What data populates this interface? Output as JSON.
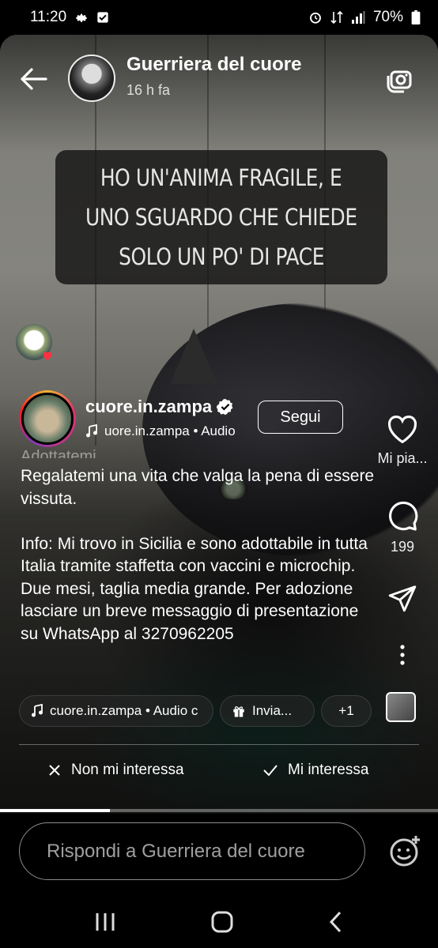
{
  "status_bar": {
    "time": "11:20",
    "battery": "70%",
    "left_icons": [
      "gear-icon",
      "checkbox-icon"
    ],
    "right_icons": [
      "alarm-icon",
      "data-icon",
      "signal-icon",
      "battery-icon"
    ]
  },
  "story_header": {
    "username": "Guerriera del cuore",
    "time_ago": "16 h fa"
  },
  "quote": {
    "lines": [
      "HO UN'ANIMA FRAGILE, E",
      "UNO SGUARDO CHE CHIEDE",
      "SOLO UN PO' DI PACE"
    ]
  },
  "post": {
    "username": "cuore.in.zampa",
    "audio": "uore.in.zampa • Audio",
    "follow_label": "Segui",
    "caption_partial": "Adottatemi.",
    "caption": "Regalatemi una vita che valga la pena di essere vissuta.\n\nInfo: Mi trovo in Sicilia e sono adottabile in tutta Italia tramite staffetta con vaccini e microchip. Due mesi, taglia media grande. Per adozione lasciare un breve messaggio di presentazione su WhatsApp al 3270962205"
  },
  "actions": {
    "like_label": "Mi pia...",
    "comments_count": "199"
  },
  "chips": {
    "audio": "cuore.in.zampa • Audio c",
    "send": "Invia...",
    "more": "+1"
  },
  "feedback": {
    "not_interested": "Non mi interessa",
    "interested": "Mi interessa"
  },
  "reply": {
    "placeholder": "Rispondi a Guerriera del cuore"
  },
  "progress": 0.25,
  "colors": {
    "background": "#000000",
    "text": "#ffffff",
    "verified": "#ffffff"
  }
}
